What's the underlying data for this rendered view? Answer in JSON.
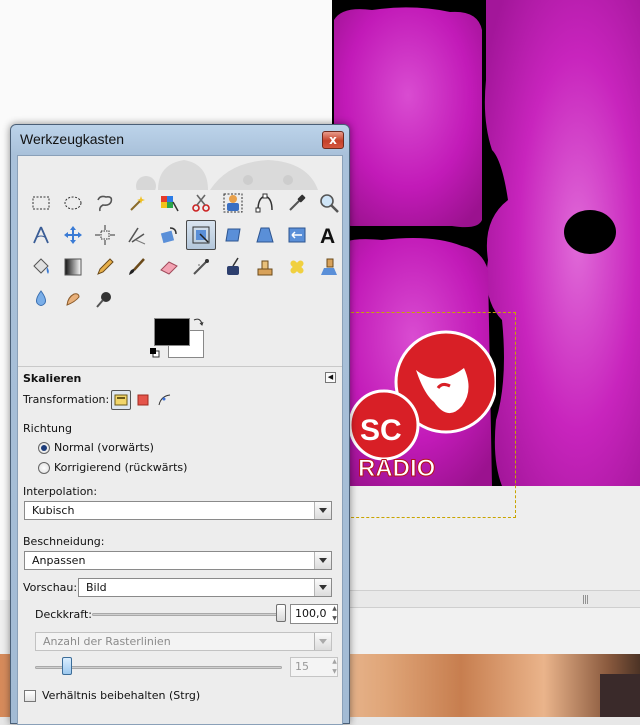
{
  "window": {
    "title": "Werkzeugkasten",
    "close_label": "x"
  },
  "tools": [
    {
      "name": "rect-select-icon"
    },
    {
      "name": "ellipse-select-icon"
    },
    {
      "name": "free-select-icon"
    },
    {
      "name": "fuzzy-select-icon"
    },
    {
      "name": "color-select-icon"
    },
    {
      "name": "scissors-select-icon"
    },
    {
      "name": "foreground-select-icon"
    },
    {
      "name": "paths-icon"
    },
    {
      "name": "color-picker-icon"
    },
    {
      "name": "zoom-icon"
    },
    {
      "name": "measure-icon"
    },
    {
      "name": "move-icon"
    },
    {
      "name": "align-icon"
    },
    {
      "name": "crop-icon"
    },
    {
      "name": "rotate-icon"
    },
    {
      "name": "scale-icon"
    },
    {
      "name": "shear-icon"
    },
    {
      "name": "perspective-icon"
    },
    {
      "name": "flip-icon"
    },
    {
      "name": "text-icon"
    },
    {
      "name": "bucket-fill-icon"
    },
    {
      "name": "blend-icon"
    },
    {
      "name": "pencil-icon"
    },
    {
      "name": "paintbrush-icon"
    },
    {
      "name": "eraser-icon"
    },
    {
      "name": "airbrush-icon"
    },
    {
      "name": "ink-icon"
    },
    {
      "name": "clone-icon"
    },
    {
      "name": "heal-icon"
    },
    {
      "name": "perspective-clone-icon"
    },
    {
      "name": "blur-icon"
    },
    {
      "name": "smudge-icon"
    },
    {
      "name": "dodge-burn-icon"
    }
  ],
  "colors": {
    "foreground": "#000000",
    "background": "#ffffff",
    "accent": "#c21ab8"
  },
  "options": {
    "title": "Skalieren",
    "transformation_label": "Transformation:",
    "direction_label": "Richtung",
    "direction_normal": "Normal (vorwärts)",
    "direction_corrective": "Korrigierend (rückwärts)",
    "interpolation_label": "Interpolation:",
    "interpolation_value": "Kubisch",
    "clipping_label": "Beschneidung:",
    "clipping_value": "Anpassen",
    "preview_label": "Vorschau:",
    "preview_value": "Bild",
    "opacity_label": "Deckkraft:",
    "opacity_value": "100,0",
    "opacity_fraction": 1.0,
    "grid_type_value": "Anzahl der Rasterlinien",
    "grid_count_value": "15",
    "keep_aspect_label": "Verhältnis beibehalten (Strg)"
  },
  "canvas": {
    "logo_line1": "SC",
    "logo_line2": "RADIO"
  }
}
